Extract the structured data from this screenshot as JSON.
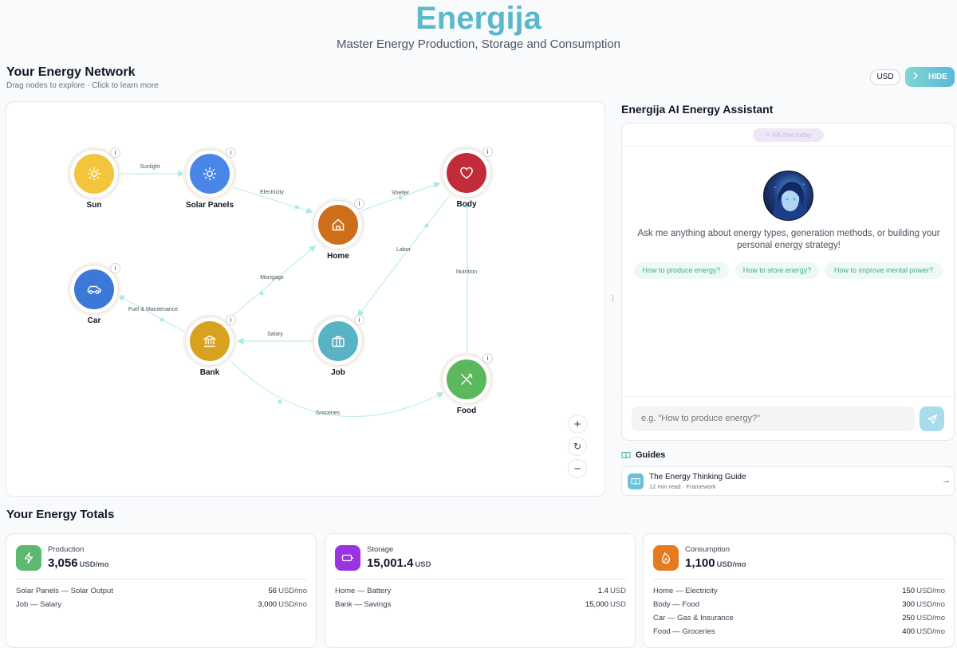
{
  "header": {
    "title": "Energija",
    "subtitle": "Master Energy Production, Storage and Consumption"
  },
  "network": {
    "title": "Your Energy Network",
    "subtitle": "Drag nodes to explore · Click to learn more",
    "info_glyph": "i",
    "nodes": {
      "sun": {
        "label": "Sun",
        "color": "#f2c53d",
        "icon": "sun-icon"
      },
      "solar": {
        "label": "Solar Panels",
        "color": "#4a86e8",
        "icon": "sun-icon"
      },
      "home": {
        "label": "Home",
        "color": "#cd6e1a",
        "icon": "home-icon"
      },
      "body": {
        "label": "Body",
        "color": "#c22c3a",
        "icon": "heart-icon"
      },
      "car": {
        "label": "Car",
        "color": "#3b78d8",
        "icon": "car-icon"
      },
      "bank": {
        "label": "Bank",
        "color": "#d9a21e",
        "icon": "bank-icon"
      },
      "job": {
        "label": "Job",
        "color": "#58b3c5",
        "icon": "briefcase-icon"
      },
      "food": {
        "label": "Food",
        "color": "#5cb85c",
        "icon": "utensils-icon"
      }
    },
    "edges": {
      "sunlight": "Sunlight",
      "electricity": "Electricity",
      "shelter": "Shelter",
      "labor": "Labor",
      "mortgage": "Mortgage",
      "nutrition": "Nutrition",
      "fuel": "Fuel & Maintenance",
      "salary": "Salary",
      "groceries": "Groceries"
    },
    "zoom_in": "+",
    "zoom_out": "−",
    "reset": "↻"
  },
  "toolbar": {
    "currency": "USD",
    "hide_label": "HIDE"
  },
  "assistant": {
    "title": "Energija AI Energy Assistant",
    "uses_badge": "4/5 free today",
    "prompt": "Ask me anything about energy types, generation methods, or building your personal energy strategy!",
    "suggestions": [
      "How to produce energy?",
      "How to store energy?",
      "How to improve mental power?"
    ],
    "input_placeholder": "e.g. \"How to produce energy?\""
  },
  "guides": {
    "heading": "Guides",
    "items": [
      {
        "title": "The Energy Thinking Guide",
        "meta": "12 min read · Framework"
      }
    ]
  },
  "totals": {
    "title": "Your Energy Totals",
    "cards": [
      {
        "label": "Production",
        "value": "3,056",
        "unit": "USD/mo",
        "color": "#5cb96f",
        "icon": "bolt-icon",
        "rows": [
          {
            "label": "Solar Panels — Solar Output",
            "value": "56",
            "unit": "USD/mo"
          },
          {
            "label": "Job — Salary",
            "value": "3,000",
            "unit": "USD/mo"
          }
        ]
      },
      {
        "label": "Storage",
        "value": "15,001.4",
        "unit": "USD",
        "color": "#9b33e0",
        "icon": "battery-icon",
        "rows": [
          {
            "label": "Home — Battery",
            "value": "1.4",
            "unit": "USD"
          },
          {
            "label": "Bank — Savings",
            "value": "15,000",
            "unit": "USD"
          }
        ]
      },
      {
        "label": "Consumption",
        "value": "1,100",
        "unit": "USD/mo",
        "color": "#e57a1e",
        "icon": "flame-icon",
        "rows": [
          {
            "label": "Home — Electricity",
            "value": "150",
            "unit": "USD/mo"
          },
          {
            "label": "Body — Food",
            "value": "300",
            "unit": "USD/mo"
          },
          {
            "label": "Car — Gas & Insurance",
            "value": "250",
            "unit": "USD/mo"
          },
          {
            "label": "Food — Groceries",
            "value": "400",
            "unit": "USD/mo"
          }
        ]
      }
    ]
  }
}
